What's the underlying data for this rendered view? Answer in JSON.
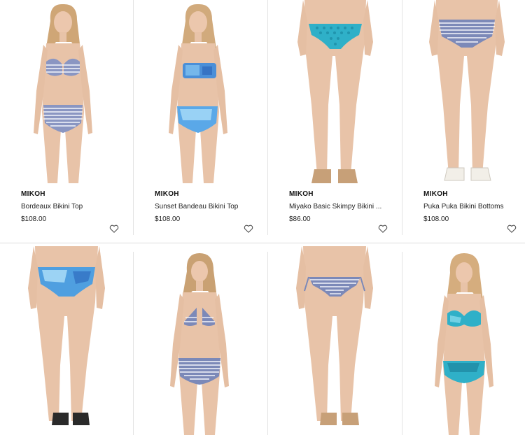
{
  "products": [
    {
      "brand": "MIKOH",
      "name": "Bordeaux Bikini Top",
      "price": "$108.00",
      "icon": "heart-icon"
    },
    {
      "brand": "MIKOH",
      "name": "Sunset Bandeau Bikini Top",
      "price": "$108.00",
      "icon": "heart-icon"
    },
    {
      "brand": "MIKOH",
      "name": "Miyako Basic Skimpy Bikini ...",
      "price": "$86.00",
      "icon": "heart-icon"
    },
    {
      "brand": "MIKOH",
      "name": "Puka Puka Bikini Bottoms",
      "price": "$108.00",
      "icon": "heart-icon"
    },
    {
      "brand": "",
      "name": "",
      "price": ""
    },
    {
      "brand": "",
      "name": "",
      "price": ""
    },
    {
      "brand": "",
      "name": "",
      "price": ""
    },
    {
      "brand": "",
      "name": "",
      "price": ""
    }
  ],
  "colors": {
    "skin": "#e8c3a8",
    "hair": "#c9a173",
    "stripe": "#7c89b8",
    "blue_print": "#4f9fe0",
    "teal": "#3fb3c9",
    "divider": "#dcdcdc"
  }
}
